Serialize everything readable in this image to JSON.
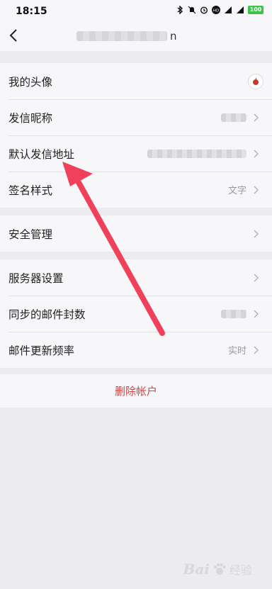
{
  "status": {
    "time": "18:15",
    "battery": "100"
  },
  "nav": {
    "title_tail": "n"
  },
  "rows_group1": [
    {
      "label": "我的头像"
    },
    {
      "label": "发信昵称"
    },
    {
      "label": "默认发信地址"
    },
    {
      "label": "签名样式",
      "value": "文字"
    }
  ],
  "rows_group2": [
    {
      "label": "安全管理"
    }
  ],
  "rows_group3": [
    {
      "label": "服务器设置"
    },
    {
      "label": "同步的邮件封数"
    },
    {
      "label": "邮件更新频率",
      "value": "实时"
    }
  ],
  "delete_label": "删除帐户",
  "watermark": {
    "brand": "Bai",
    "sub": "经验"
  },
  "colors": {
    "accent_red": "#d04646",
    "arrow": "#f0405a",
    "background": "#ececef"
  }
}
